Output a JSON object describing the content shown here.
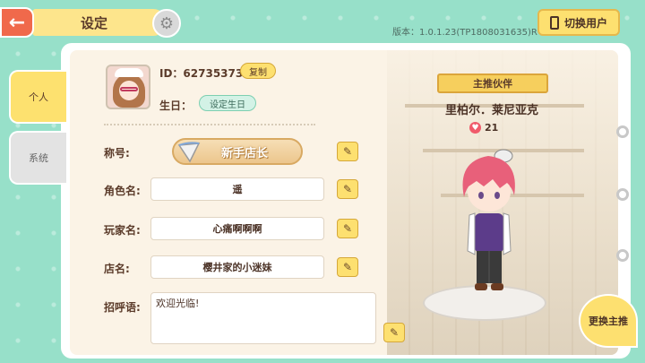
{
  "header": {
    "back_icon": "arrow-left-icon",
    "title": "设定",
    "settings_icon": "gear-icon",
    "version": "版本：1.0.1.23(TP1808031635)R",
    "switch_user_label": "切换用户"
  },
  "tabs": [
    {
      "label": "个人",
      "selected": true
    },
    {
      "label": "系统",
      "selected": false
    }
  ],
  "profile": {
    "id_text": "ID：62735373",
    "copy_label": "复制",
    "birthday_label": "生日：",
    "set_birthday_label": "设定生日",
    "title_label": "称号:",
    "title_value": "新手店长",
    "role_label": "角色名:",
    "role_value": "遥",
    "player_label": "玩家名:",
    "player_value": "心痛啊啊啊",
    "shop_label": "店名:",
    "shop_value": "樱井家的小迷妹",
    "greeting_label": "招呼语:",
    "greeting_value": "欢迎光临!"
  },
  "partner": {
    "ribbon_label": "主推伙伴",
    "name": "里柏尔．莱尼亚克",
    "affection": "21",
    "change_label": "更换主推"
  },
  "colors": {
    "accent_yellow": "#fde070",
    "back_red": "#f0694b",
    "bg_mint": "#97e0c9"
  }
}
